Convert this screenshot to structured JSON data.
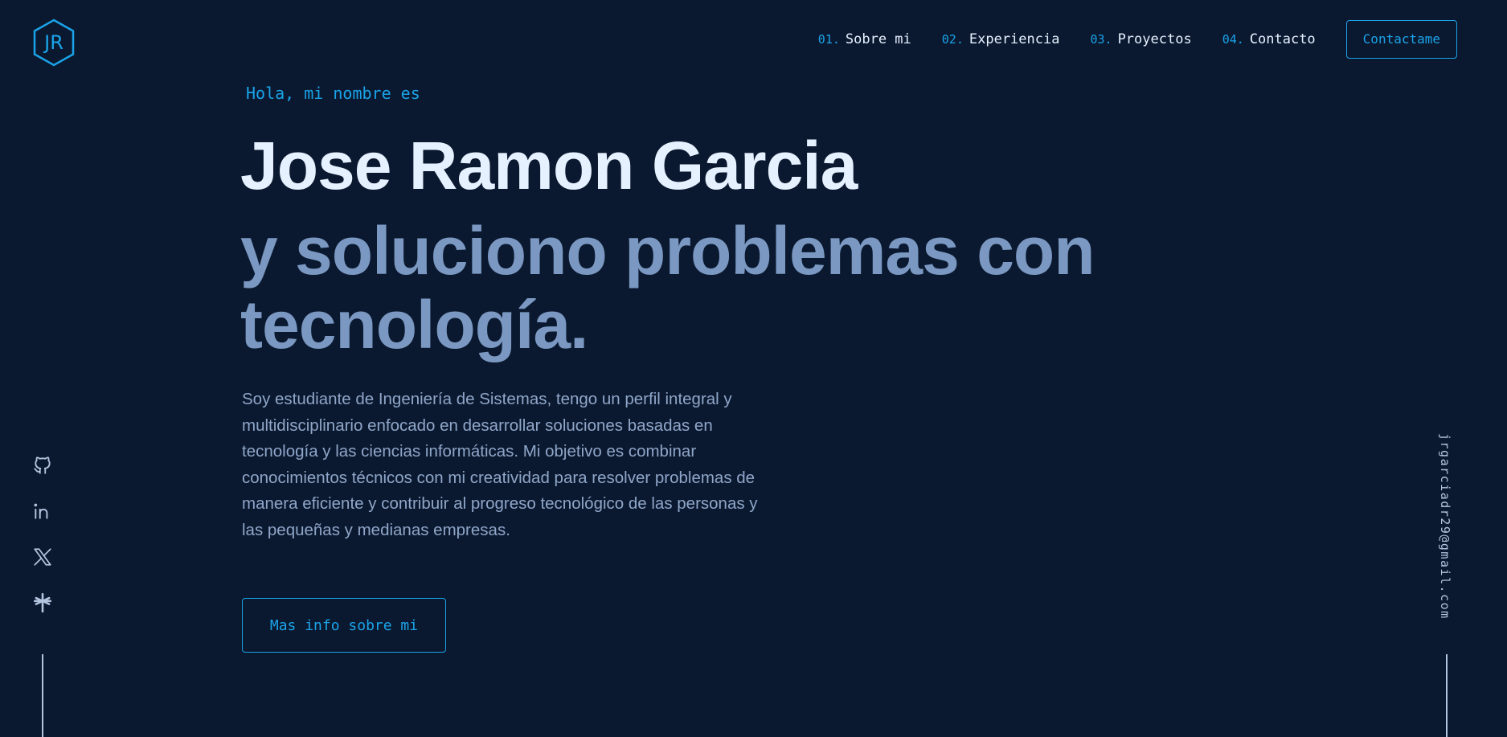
{
  "logo": {
    "text": "JR",
    "icon": "hexagon-logo-icon"
  },
  "nav": {
    "items": [
      {
        "num": "01.",
        "label": "Sobre mi"
      },
      {
        "num": "02.",
        "label": "Experiencia"
      },
      {
        "num": "03.",
        "label": "Proyectos"
      },
      {
        "num": "04.",
        "label": "Contacto"
      }
    ],
    "cta": "Contactame"
  },
  "hero": {
    "greeting": "Hola, mi nombre es",
    "name": "Jose Ramon Garcia",
    "tagline": "y soluciono problemas con tecnología.",
    "description": "Soy estudiante de Ingeniería de Sistemas, tengo un perfil integral y multidisciplinario enfocado en desarrollar soluciones basadas en tecnología y las ciencias informáticas. Mi objetivo es combinar conocimientos técnicos con mi creatividad para resolver problemas de manera eficiente y contribuir al progreso tecnológico de las personas y las pequeñas y medianas empresas.",
    "button": "Mas info sobre mi"
  },
  "social": [
    {
      "icon": "github-icon"
    },
    {
      "icon": "linkedin-icon"
    },
    {
      "icon": "x-twitter-icon"
    },
    {
      "icon": "linktree-icon"
    }
  ],
  "email": "jrgarciadr29@gmail.com",
  "colors": {
    "background": "#0b1930",
    "accent": "#1aa3e8",
    "heading": "#e6f1ff",
    "subheading": "#7a98c1",
    "body_text": "#8fa6c8"
  }
}
